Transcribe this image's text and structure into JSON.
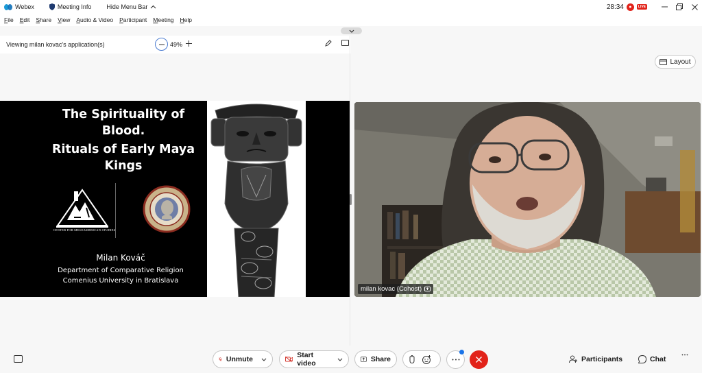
{
  "titlebar": {
    "app_name": "Webex",
    "meeting_info": "Meeting Info",
    "hide_menu": "Hide Menu Bar",
    "clock": "28:34",
    "live": "LIVE"
  },
  "menu": [
    "File",
    "Edit",
    "Share",
    "View",
    "Audio & Video",
    "Participant",
    "Meeting",
    "Help"
  ],
  "share": {
    "viewing_label": "Viewing milan kovac's application(s)",
    "zoom": "49%"
  },
  "slide": {
    "title_line1": "The Spirituality of",
    "title_line2": "Blood.",
    "title_line3": "Rituals of Early Maya",
    "title_line4": "Kings",
    "logo_caption": "CENTER FOR MESOAMERICAN STUDIES",
    "author": "Milan Kováč",
    "department": "Department of Comparative Religion",
    "university": "Comenius University in Bratislava"
  },
  "video": {
    "layout_label": "Layout",
    "participant_name": "milan kovac (Cohost)"
  },
  "controls": {
    "unmute": "Unmute",
    "start_video": "Start video",
    "share": "Share",
    "participants": "Participants",
    "chat": "Chat"
  },
  "colors": {
    "accent_red": "#e2231a",
    "accent_blue": "#1a73e8"
  }
}
